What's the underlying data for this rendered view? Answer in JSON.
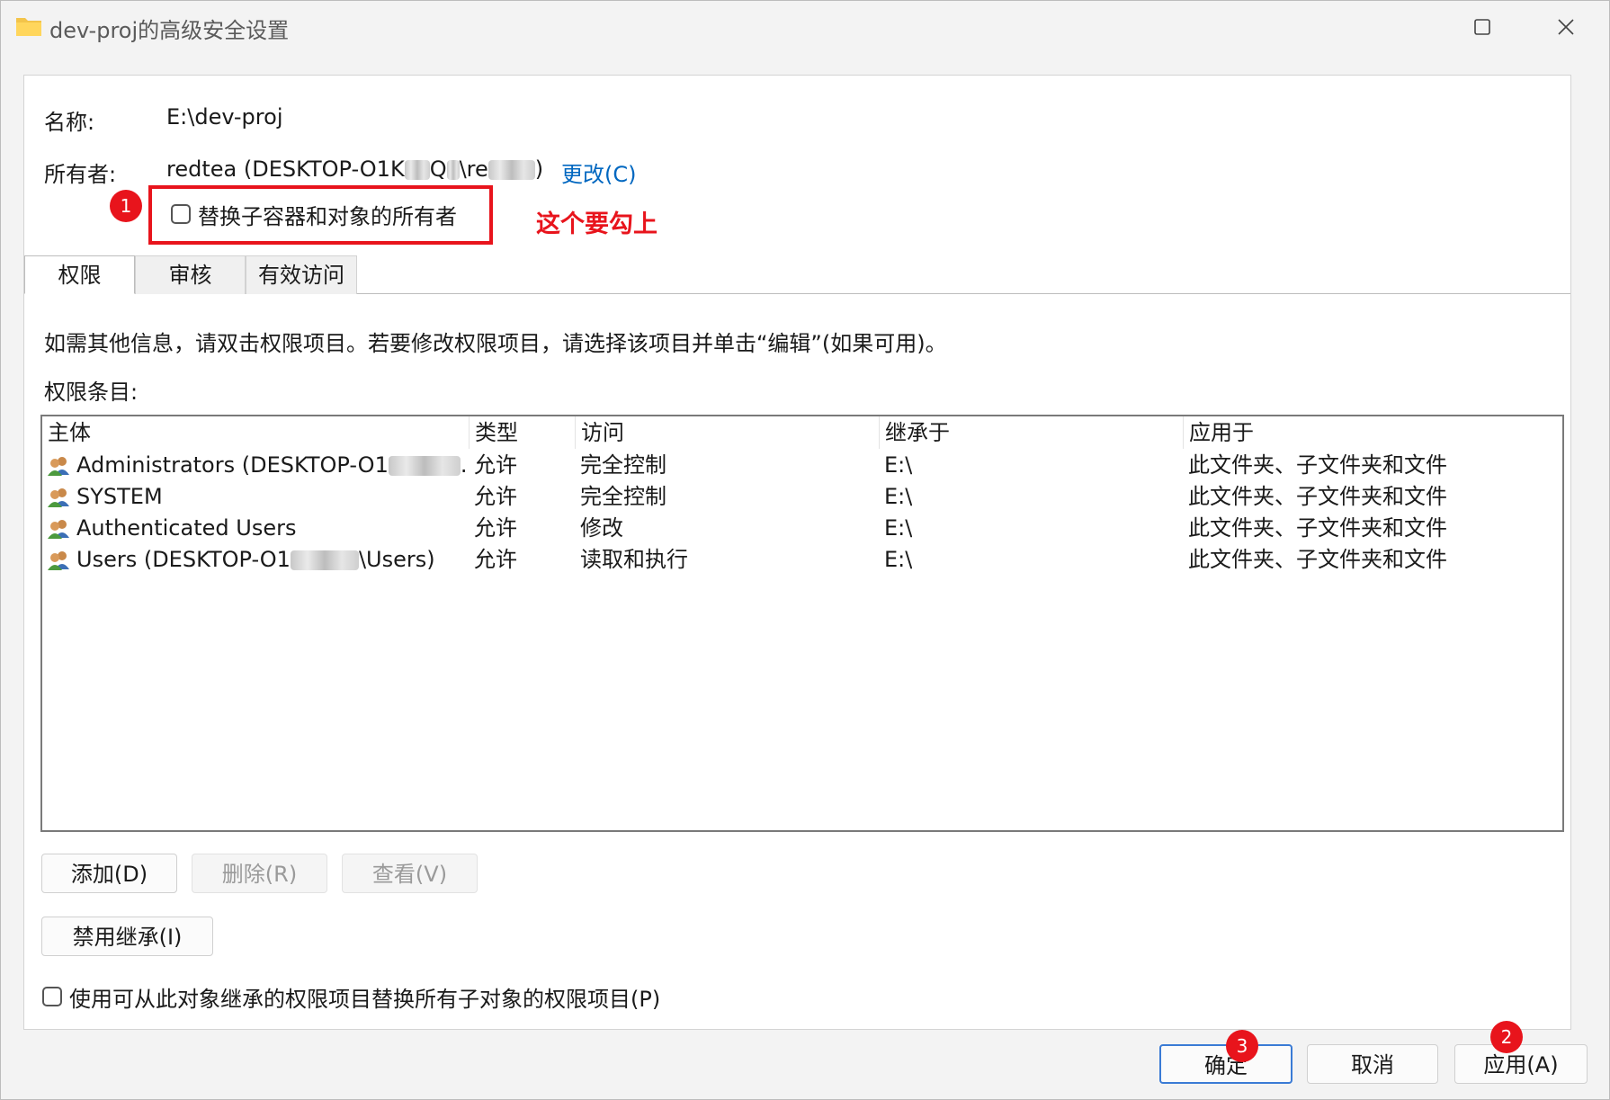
{
  "window": {
    "title": "dev-proj的高级安全设置",
    "icons": {
      "app": "folder-icon",
      "maximize": "maximize-icon",
      "close": "close-icon"
    }
  },
  "info": {
    "name_label": "名称:",
    "name_value": "E:\\dev-proj",
    "owner_label": "所有者:",
    "owner_value_start": "redtea (DESKTOP-O1K",
    "owner_value_mid": "Q",
    "owner_value_mid2": "\\re",
    "owner_value_end": ")",
    "owner_change_link": "更改(C)",
    "replace_owner_checkbox_label": "替换子容器和对象的所有者",
    "replace_owner_checked": false
  },
  "annotations": {
    "badge_1": "1",
    "badge_2": "2",
    "badge_3": "3",
    "note": "这个要勾上",
    "color": "#e8141c"
  },
  "tabs": [
    {
      "label": "权限",
      "active": true
    },
    {
      "label": "审核",
      "active": false
    },
    {
      "label": "有效访问",
      "active": false
    }
  ],
  "permissions": {
    "help_text": "如需其他信息，请双击权限项目。若要修改权限项目，请选择该项目并单击“编辑”(如果可用)。",
    "entries_label": "权限条目:",
    "columns": [
      "主体",
      "类型",
      "访问",
      "继承于",
      "应用于"
    ],
    "rows": [
      {
        "principal": "Administrators (DESKTOP-O1",
        "principal_suffix": "...",
        "type": "允许",
        "access": "完全控制",
        "inherited_from": "E:\\",
        "applies_to": "此文件夹、子文件夹和文件"
      },
      {
        "principal": "SYSTEM",
        "principal_suffix": "",
        "type": "允许",
        "access": "完全控制",
        "inherited_from": "E:\\",
        "applies_to": "此文件夹、子文件夹和文件"
      },
      {
        "principal": "Authenticated Users",
        "principal_suffix": "",
        "type": "允许",
        "access": "修改",
        "inherited_from": "E:\\",
        "applies_to": "此文件夹、子文件夹和文件"
      },
      {
        "principal": "Users (DESKTOP-O1",
        "principal_suffix": "\\Users)",
        "type": "允许",
        "access": "读取和执行",
        "inherited_from": "E:\\",
        "applies_to": "此文件夹、子文件夹和文件"
      }
    ],
    "row_icon": "user-group-icon"
  },
  "buttons": {
    "add": "添加(D)",
    "remove": "删除(R)",
    "view": "查看(V)",
    "disable_inheritance": "禁用继承(I)",
    "replace_child_checkbox_label": "使用可从此对象继承的权限项目替换所有子对象的权限项目(P)",
    "replace_child_checked": false,
    "ok": "确定",
    "cancel": "取消",
    "apply": "应用(A)"
  }
}
